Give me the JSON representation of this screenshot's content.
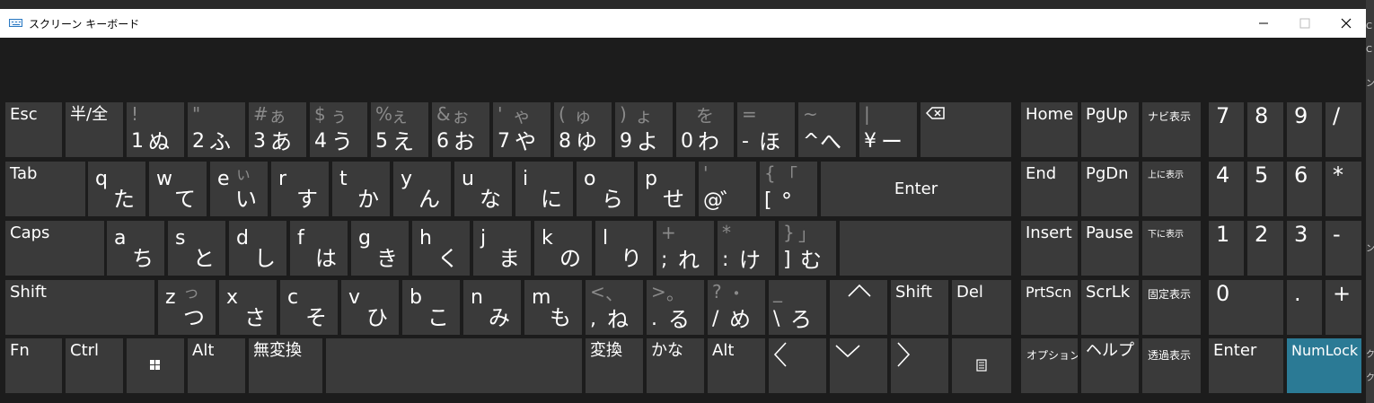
{
  "window": {
    "title": "スクリーン キーボード"
  },
  "edge": [
    "C",
    "C",
    "ン",
    "ン",
    "ク",
    "ク"
  ],
  "keys": {
    "esc": "Esc",
    "hankaku": "半/全",
    "n1": {
      "sym": "!",
      "kana_shift": "",
      "base": "1",
      "kana": "ぬ"
    },
    "n2": {
      "sym": "\"",
      "kana_shift": "",
      "base": "2",
      "kana": "ふ"
    },
    "n3": {
      "sym": "#",
      "kana_shift": "ぁ",
      "base": "3",
      "kana": "あ"
    },
    "n4": {
      "sym": "$",
      "kana_shift": "ぅ",
      "base": "4",
      "kana": "う"
    },
    "n5": {
      "sym": "%",
      "kana_shift": "ぇ",
      "base": "5",
      "kana": "え"
    },
    "n6": {
      "sym": "&",
      "kana_shift": "ぉ",
      "base": "6",
      "kana": "お"
    },
    "n7": {
      "sym": "'",
      "kana_shift": "ゃ",
      "base": "7",
      "kana": "や"
    },
    "n8": {
      "sym": "(",
      "kana_shift": "ゅ",
      "base": "8",
      "kana": "ゆ"
    },
    "n9": {
      "sym": ")",
      "kana_shift": "ょ",
      "base": "9",
      "kana": "よ"
    },
    "n0": {
      "sym": "",
      "kana_shift": "を",
      "base": "0",
      "kana": "わ"
    },
    "minus": {
      "sym": "=",
      "kana_shift": "",
      "base": "-",
      "kana": "ほ"
    },
    "caret": {
      "sym": "~",
      "kana_shift": "",
      "base": "^",
      "kana": "へ"
    },
    "yen": {
      "sym": "|",
      "kana_shift": "",
      "base": "¥",
      "kana": "ー"
    },
    "tab": "Tab",
    "q": {
      "letter": "q",
      "kana_shift": "",
      "kana": "た"
    },
    "w": {
      "letter": "w",
      "kana_shift": "",
      "kana": "て"
    },
    "e": {
      "letter": "e",
      "kana_shift": "ぃ",
      "kana": "い"
    },
    "r": {
      "letter": "r",
      "kana_shift": "",
      "kana": "す"
    },
    "t": {
      "letter": "t",
      "kana_shift": "",
      "kana": "か"
    },
    "y": {
      "letter": "y",
      "kana_shift": "",
      "kana": "ん"
    },
    "u": {
      "letter": "u",
      "kana_shift": "",
      "kana": "な"
    },
    "i": {
      "letter": "i",
      "kana_shift": "",
      "kana": "に"
    },
    "o": {
      "letter": "o",
      "kana_shift": "",
      "kana": "ら"
    },
    "p": {
      "letter": "p",
      "kana_shift": "",
      "kana": "せ"
    },
    "at": {
      "sym": "'",
      "kana_shift": "",
      "base": "@",
      "kana": "゛"
    },
    "bracket": {
      "sym": "{",
      "kana_shift": "「",
      "base": "[",
      "kana": "°"
    },
    "enter": "Enter",
    "caps": "Caps",
    "a": {
      "letter": "a",
      "kana_shift": "",
      "kana": "ち"
    },
    "s": {
      "letter": "s",
      "kana_shift": "",
      "kana": "と"
    },
    "d": {
      "letter": "d",
      "kana_shift": "",
      "kana": "し"
    },
    "f": {
      "letter": "f",
      "kana_shift": "",
      "kana": "は"
    },
    "g": {
      "letter": "g",
      "kana_shift": "",
      "kana": "き"
    },
    "h": {
      "letter": "h",
      "kana_shift": "",
      "kana": "く"
    },
    "j": {
      "letter": "j",
      "kana_shift": "",
      "kana": "ま"
    },
    "k": {
      "letter": "k",
      "kana_shift": "",
      "kana": "の"
    },
    "l": {
      "letter": "l",
      "kana_shift": "",
      "kana": "り"
    },
    "semi": {
      "sym": "+",
      "kana_shift": "",
      "base": ";",
      "kana": "れ"
    },
    "colon": {
      "sym": "*",
      "kana_shift": "",
      "base": ":",
      "kana": "け"
    },
    "rbracket": {
      "sym": "}",
      "kana_shift": "」",
      "base": "]",
      "kana": "む"
    },
    "shift": "Shift",
    "z": {
      "letter": "z",
      "kana_shift": "っ",
      "kana": "つ"
    },
    "x": {
      "letter": "x",
      "kana_shift": "",
      "kana": "さ"
    },
    "c": {
      "letter": "c",
      "kana_shift": "",
      "kana": "そ"
    },
    "v": {
      "letter": "v",
      "kana_shift": "",
      "kana": "ひ"
    },
    "b": {
      "letter": "b",
      "kana_shift": "",
      "kana": "こ"
    },
    "n": {
      "letter": "n",
      "kana_shift": "",
      "kana": "み"
    },
    "m": {
      "letter": "m",
      "kana_shift": "",
      "kana": "も"
    },
    "comma": {
      "sym": "<",
      "kana_shift": "、",
      "base": ",",
      "kana": "ね"
    },
    "period": {
      "sym": ">",
      "kana_shift": "。",
      "base": ".",
      "kana": "る"
    },
    "slash": {
      "sym": "?",
      "kana_shift": "・",
      "base": "/",
      "kana": "め"
    },
    "backslash": {
      "sym": "_",
      "kana_shift": "",
      "base": "\\",
      "kana": "ろ"
    },
    "shift_r": "Shift",
    "del": "Del",
    "fn": "Fn",
    "ctrl": "Ctrl",
    "alt": "Alt",
    "muhenkan": "無変換",
    "henkan": "変換",
    "kana_key": "かな",
    "alt_r": "Alt",
    "home": "Home",
    "pgup": "PgUp",
    "navi": "ナビ表示",
    "end": "End",
    "pgdn": "PgDn",
    "moveup": "上に表示",
    "insert": "Insert",
    "pause": "Pause",
    "movedown": "下に表示",
    "prtscn": "PrtScn",
    "scrlk": "ScrLk",
    "dock": "固定表示",
    "options": "オプション",
    "help": "ヘルプ",
    "fade": "透過表示",
    "np7": "7",
    "np8": "8",
    "np9": "9",
    "npdiv": "/",
    "np4": "4",
    "np5": "5",
    "np6": "6",
    "npmul": "*",
    "np1": "1",
    "np2": "2",
    "np3": "3",
    "npsub": "-",
    "np0": "0",
    "npdot": ".",
    "npadd": "+",
    "npenter": "Enter",
    "numlock": "NumLock"
  }
}
